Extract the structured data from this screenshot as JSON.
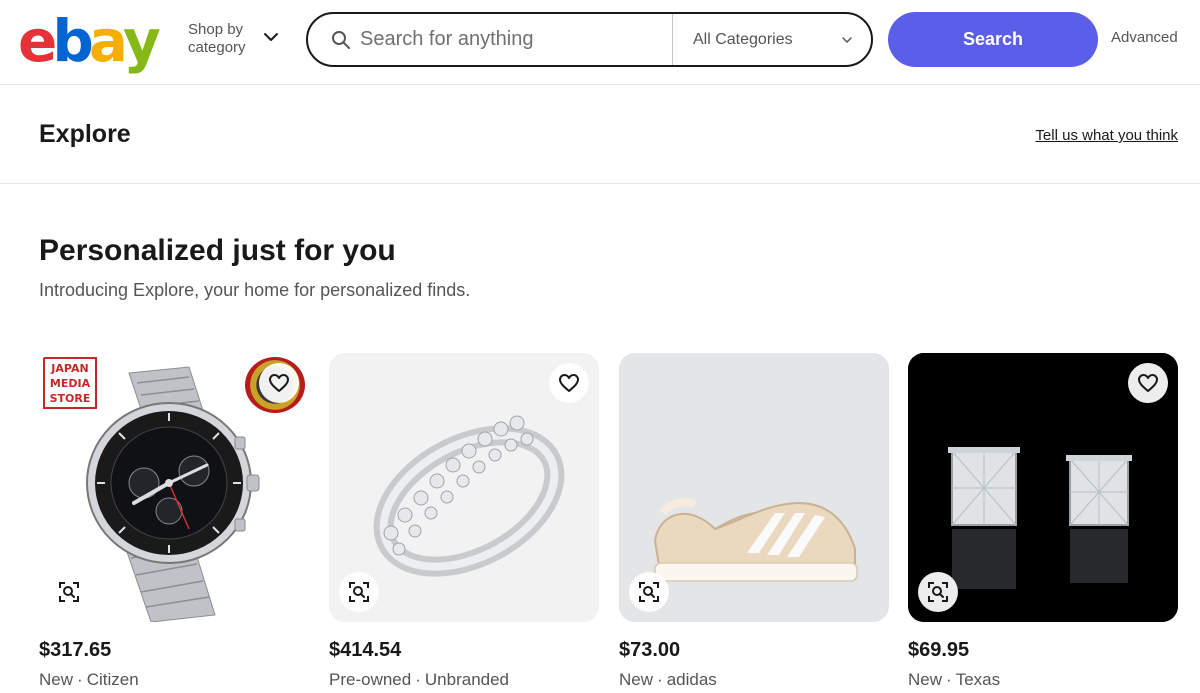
{
  "header": {
    "logo": [
      "e",
      "b",
      "a",
      "y"
    ],
    "logo_colors": [
      "#e53238",
      "#0064d2",
      "#f5af02",
      "#86b817"
    ],
    "shop_by_category": "Shop by category",
    "search": {
      "placeholder": "Search for anything",
      "category": "All Categories"
    },
    "search_button": "Search",
    "advanced": "Advanced"
  },
  "explore": {
    "title": "Explore",
    "feedback": "Tell us what you think"
  },
  "section": {
    "title": "Personalized just for you",
    "subtitle": "Introducing Explore, your home for personalized finds."
  },
  "colors": {
    "accent": "#5b5ee8",
    "text": "#191919",
    "muted": "#555555"
  },
  "cards": [
    {
      "price": "$317.65",
      "condition": "New",
      "brand": "Citizen",
      "image": "watch",
      "badge": [
        "JAPAN",
        "MEDIA",
        "STORE"
      ],
      "icons": [
        "heart-icon",
        "visual-search-icon"
      ]
    },
    {
      "price": "$414.54",
      "condition": "Pre-owned",
      "brand": "Unbranded",
      "image": "ring",
      "icons": [
        "heart-icon",
        "visual-search-icon"
      ]
    },
    {
      "price": "$73.00",
      "condition": "New",
      "brand": "adidas",
      "image": "sneaker",
      "icons": [
        "heart-icon",
        "visual-search-icon"
      ]
    },
    {
      "price": "$69.95",
      "condition": "New",
      "brand": "Texas",
      "image": "earrings",
      "icons": [
        "heart-icon",
        "visual-search-icon"
      ]
    }
  ]
}
